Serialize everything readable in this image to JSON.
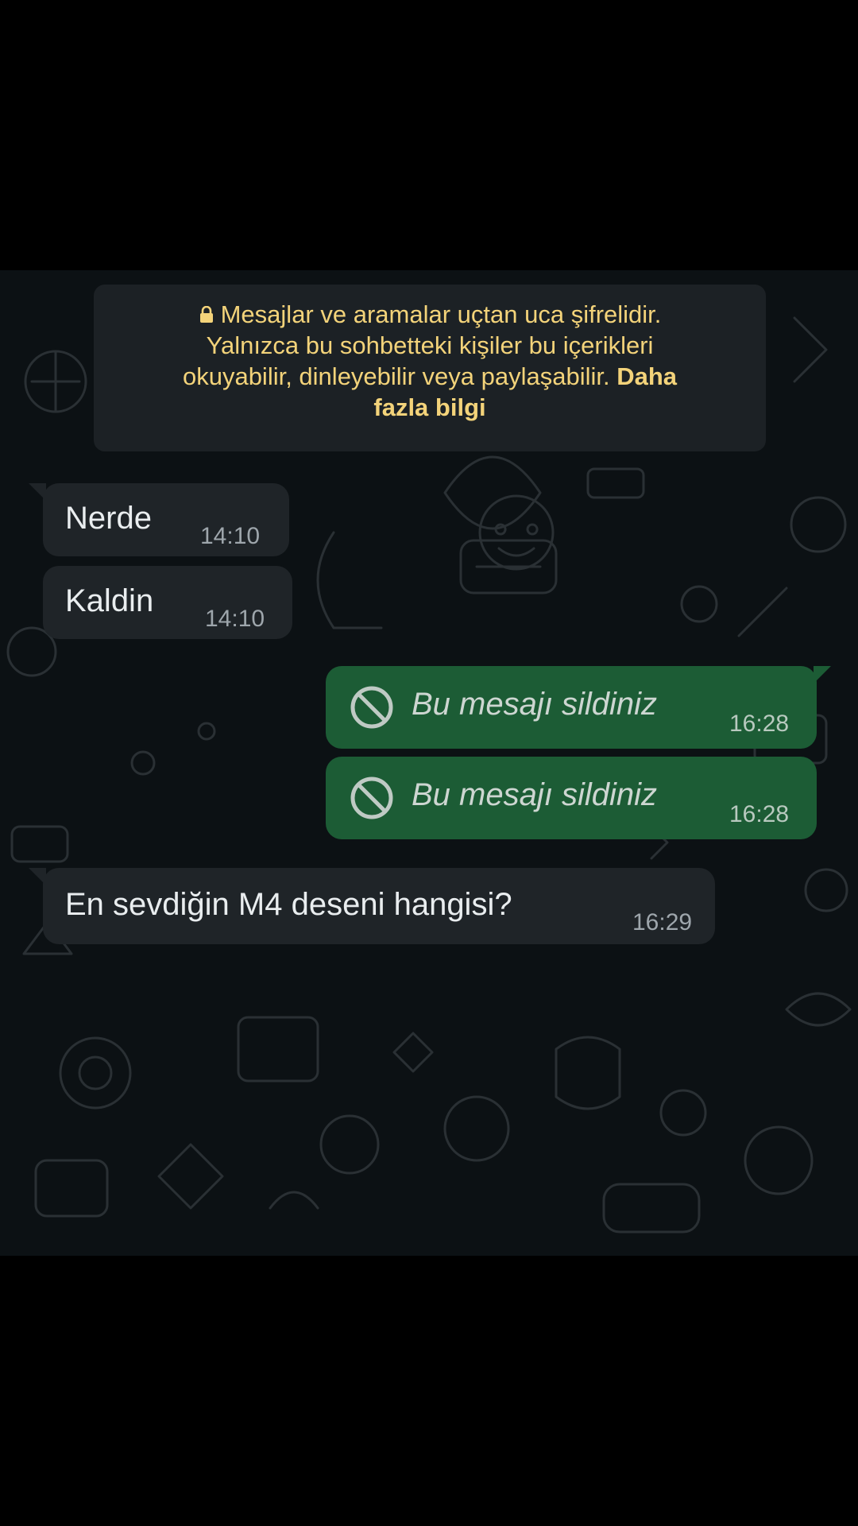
{
  "encryption_notice": {
    "line1": "Mesajlar ve aramalar uçtan uca şifrelidir.",
    "line2": "Yalnızca bu sohbetteki kişiler bu içerikleri",
    "line3": "okuyabilir, dinleyebilir veya paylaşabilir.",
    "learn_more_a": "Daha",
    "learn_more_b": "fazla bilgi",
    "icon": "lock-icon"
  },
  "messages": [
    {
      "direction": "incoming",
      "text": "Nerde",
      "time": "14:10"
    },
    {
      "direction": "incoming",
      "text": "Kaldin",
      "time": "14:10"
    },
    {
      "direction": "outgoing",
      "deleted": true,
      "text": "Bu mesajı sildiniz",
      "time": "16:28",
      "icon": "ban-icon"
    },
    {
      "direction": "outgoing",
      "deleted": true,
      "text": "Bu mesajı sildiniz",
      "time": "16:28",
      "icon": "ban-icon"
    },
    {
      "direction": "incoming",
      "text": "En sevdiğin M4 deseni hangisi?",
      "time": "16:29"
    }
  ],
  "colors": {
    "background": "#000000",
    "chat_background": "#0c1114",
    "incoming_bubble": "#1f2428",
    "outgoing_bubble": "#1c5c35",
    "notice_text": "#f3d37a",
    "message_text": "#e9edef",
    "timestamp": "#9ea6ac"
  }
}
